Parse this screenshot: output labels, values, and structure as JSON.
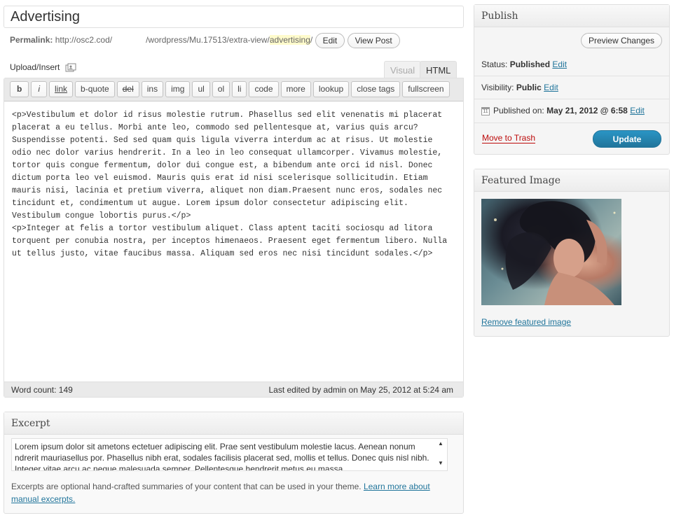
{
  "post": {
    "title": "Advertising"
  },
  "permalink": {
    "label": "Permalink:",
    "base": "http://osc2.cod/",
    "path": "/wordpress/Mu.17513/extra-view/",
    "slug": "advertising",
    "trailing": "/",
    "edit_label": "Edit",
    "view_label": "View Post"
  },
  "upload": {
    "label": "Upload/Insert",
    "icon": "media-icon"
  },
  "tabs": {
    "visual": "Visual",
    "html": "HTML"
  },
  "toolbar": {
    "buttons": [
      "b",
      "i",
      "link",
      "b-quote",
      "del",
      "ins",
      "img",
      "ul",
      "ol",
      "li",
      "code",
      "more",
      "lookup",
      "close tags",
      "fullscreen"
    ]
  },
  "editor": {
    "content": "<p>Vestibulum et dolor id risus molestie rutrum. Phasellus sed elit venenatis mi placerat placerat a eu tellus. Morbi ante leo, commodo sed pellentesque at, varius quis arcu? Suspendisse potenti. Sed sed quam quis ligula viverra interdum ac at risus. Ut molestie odio nec dolor varius hendrerit. In a leo in leo consequat ullamcorper. Vivamus molestie, tortor quis congue fermentum, dolor dui congue est, a bibendum ante orci id nisl. Donec dictum porta leo vel euismod. Mauris quis erat id nisi scelerisque sollicitudin. Etiam mauris nisi, lacinia et pretium viverra, aliquet non diam.Praesent nunc eros, sodales nec tincidunt et, condimentum ut augue. Lorem ipsum dolor consectetur adipiscing elit. Vestibulum congue lobortis purus.</p>\n<p>Integer at felis a tortor vestibulum aliquet. Class aptent taciti sociosqu ad litora torquent per conubia nostra, per inceptos himenaeos. Praesent eget fermentum libero. Nulla ut tellus justo, vitae faucibus massa. Aliquam sed eros nec nisi tincidunt sodales.</p>",
    "word_count": "Word count: 149",
    "last_edited": "Last edited by admin on May 25, 2012 at 5:24 am"
  },
  "excerpt": {
    "heading": "Excerpt",
    "text": "Lorem ipsum dolor sit ametons ectetuer adipiscing elit. Prae sent vestibulum molestie lacus. Aenean nonum ndrerit mauriasellus por. Phasellus nibh erat, sodales facilisis placerat sed, mollis et tellus. Donec quis nisl nibh. Integer vitae arcu ac neque malesuada semper. Pellentesque hendrerit metus eu massa.",
    "help": "Excerpts are optional hand-crafted summaries of your content that can be used in your theme.",
    "learn_more": "Learn more about manual excerpts."
  },
  "publish": {
    "heading": "Publish",
    "preview_label": "Preview Changes",
    "status_label": "Status:",
    "status_value": "Published",
    "visibility_label": "Visibility:",
    "visibility_value": "Public",
    "published_label": "Published on:",
    "published_value": "May 21, 2012 @ 6:58",
    "edit": "Edit",
    "trash_label": "Move to Trash",
    "update_label": "Update"
  },
  "featured": {
    "heading": "Featured Image",
    "remove_label": "Remove featured image"
  },
  "colors": {
    "link": "#21759b",
    "trash": "#bc0b0b",
    "update_button": "#21759b",
    "slug_highlight": "#fffbcc"
  }
}
